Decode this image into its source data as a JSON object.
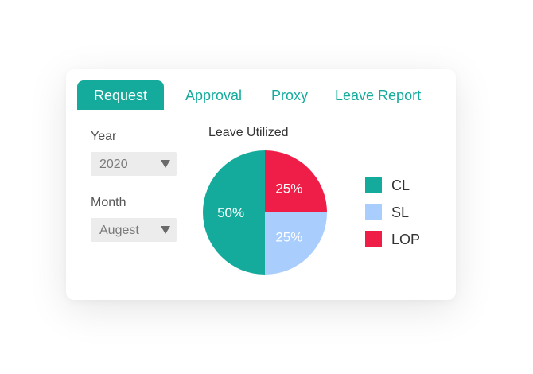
{
  "tabs": {
    "request": "Request",
    "approval": "Approval",
    "proxy": "Proxy",
    "leave_report": "Leave Report"
  },
  "filters": {
    "year_label": "Year",
    "year_value": "2020",
    "month_label": "Month",
    "month_value": "Augest"
  },
  "chart_data": {
    "type": "pie",
    "title": "Leave Utilized",
    "categories": [
      "CL",
      "SL",
      "LOP"
    ],
    "values": [
      50,
      25,
      25
    ],
    "labels": [
      "50%",
      "25%",
      "25%"
    ],
    "colors": [
      "#14ab9c",
      "#a9cdfd",
      "#ef1e48"
    ],
    "legend_position": "right"
  },
  "colors": {
    "accent": "#14ab9c"
  }
}
